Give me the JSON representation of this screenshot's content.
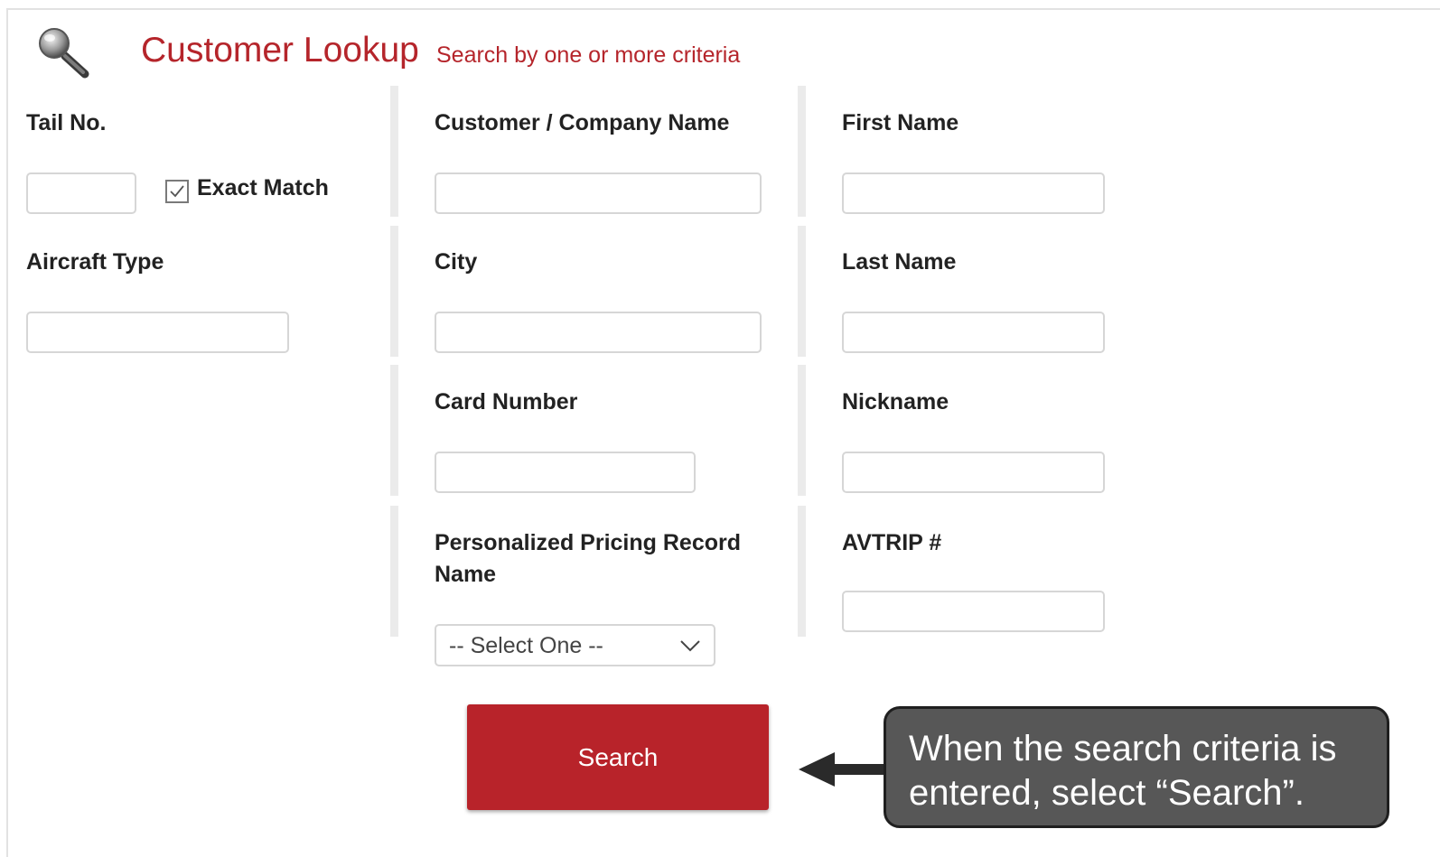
{
  "header": {
    "icon": "magnifier-icon",
    "title": "Customer Lookup",
    "subtitle": "Search by one or more criteria"
  },
  "columns": {
    "left": {
      "tail_no_label": "Tail No.",
      "exact_match_label": "Exact Match",
      "exact_match_checked": true,
      "aircraft_type_label": "Aircraft Type"
    },
    "middle": {
      "company_name_label": "Customer / Company Name",
      "city_label": "City",
      "card_number_label": "Card Number",
      "pricing_record_label": "Personalized Pricing Record Name",
      "pricing_record_select_value": "-- Select One --"
    },
    "right": {
      "first_name_label": "First Name",
      "last_name_label": "Last Name",
      "nickname_label": "Nickname",
      "avtrip_label": "AVTRIP #"
    }
  },
  "actions": {
    "search_label": "Search"
  },
  "callout": {
    "text": "When the search criteria is entered, select “Search”."
  },
  "colors": {
    "brand_red": "#b8232a",
    "title_red": "#b5252b",
    "callout_bg": "#575757"
  }
}
